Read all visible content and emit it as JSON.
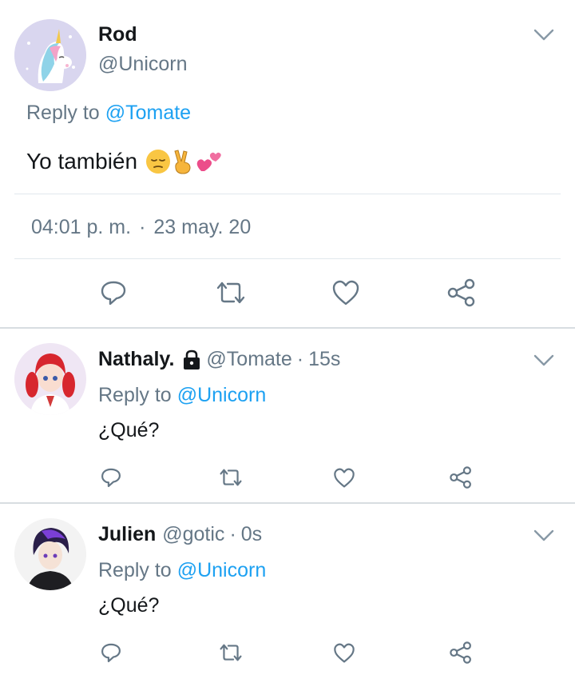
{
  "main_tweet": {
    "name": "Rod",
    "handle": "@Unicorn",
    "reply_prefix": "Reply to",
    "reply_target": "@Tomate",
    "text": "Yo también",
    "emojis": [
      "pensive-emoji",
      "victory-hand-emoji",
      "two-hearts-emoji"
    ],
    "time": "04:01 p. m.",
    "dot": "·",
    "date": "23 may. 20"
  },
  "replies": [
    {
      "name": "Nathaly.",
      "locked": true,
      "handle": "@Tomate",
      "dot": "·",
      "time": "15s",
      "reply_prefix": "Reply to",
      "reply_target": "@Unicorn",
      "text": "¿Qué?"
    },
    {
      "name": "Julien",
      "locked": false,
      "handle": "@gotic",
      "dot": "·",
      "time": "0s",
      "reply_prefix": "Reply to",
      "reply_target": "@Unicorn",
      "text": "¿Qué?"
    }
  ],
  "icons": {
    "reply": "reply-icon",
    "retweet": "retweet-icon",
    "like": "like-icon",
    "share": "share-icon",
    "more": "chevron-down-icon",
    "lock": "lock-icon"
  },
  "colors": {
    "link": "#1da1f2",
    "secondary_text": "#657786",
    "divider": "#e1e8ed",
    "icon": "#657786"
  }
}
